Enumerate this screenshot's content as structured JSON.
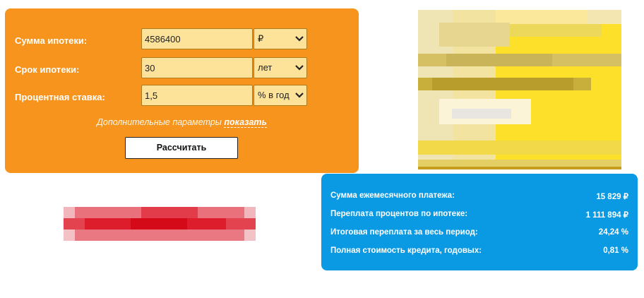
{
  "form": {
    "rows": [
      {
        "label": "Сумма ипотеки:",
        "value": "4586400",
        "unit": "₽"
      },
      {
        "label": "Срок ипотеки:",
        "value": "30",
        "unit": "лет"
      },
      {
        "label": "Процентная ставка:",
        "value": "1,5",
        "unit": "% в год"
      }
    ],
    "extra_text": "Дополнительные параметры",
    "extra_toggle": "показать",
    "submit_label": "Рассчитать"
  },
  "results": [
    {
      "label": "Сумма ежемесячного платежа:",
      "value": "15 829 ₽"
    },
    {
      "label": "Переплата процентов по ипотеке:",
      "value": "1 111 894 ₽"
    },
    {
      "label": "Итоговая переплата за весь период:",
      "value": "24,24 %"
    },
    {
      "label": "Полная стоимость кредита, годовых:",
      "value": "0,81 %"
    }
  ],
  "colors": {
    "form_panel": "#f7941d",
    "field_bg": "#fde39a",
    "results_panel": "#0a9ae4"
  }
}
